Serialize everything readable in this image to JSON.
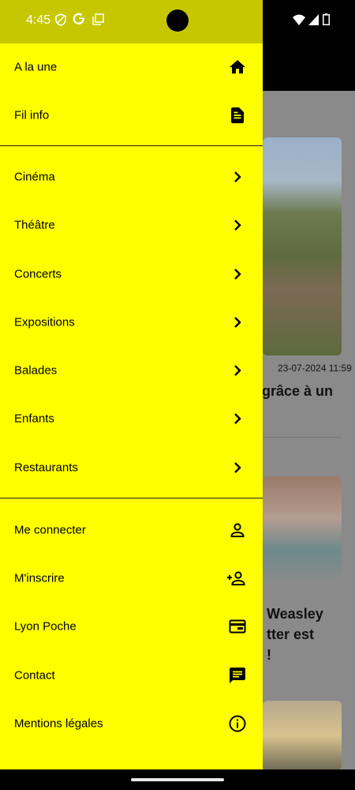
{
  "status": {
    "time": "4:45"
  },
  "menu": {
    "top": [
      {
        "label": "A la une",
        "icon": "home-icon"
      },
      {
        "label": "Fil info",
        "icon": "article-icon"
      }
    ],
    "categories": [
      {
        "label": "Cinéma"
      },
      {
        "label": "Théâtre"
      },
      {
        "label": "Concerts"
      },
      {
        "label": "Expositions"
      },
      {
        "label": "Balades"
      },
      {
        "label": "Enfants"
      },
      {
        "label": "Restaurants"
      }
    ],
    "bottom": [
      {
        "label": "Me connecter",
        "icon": "person-icon"
      },
      {
        "label": "M'inscrire",
        "icon": "person-add-icon"
      },
      {
        "label": "Lyon Poche",
        "icon": "wallet-icon"
      },
      {
        "label": "Contact",
        "icon": "chat-icon"
      },
      {
        "label": "Mentions légales",
        "icon": "info-icon"
      }
    ]
  },
  "background": {
    "date": "23-07-2024 11:59",
    "headline1": "grâce à un",
    "headline2_line1": "Weasley",
    "headline2_line2": "tter est",
    "headline2_line3": "!"
  },
  "colors": {
    "drawer": "#ffff00",
    "statusbar": "#c7c700"
  }
}
